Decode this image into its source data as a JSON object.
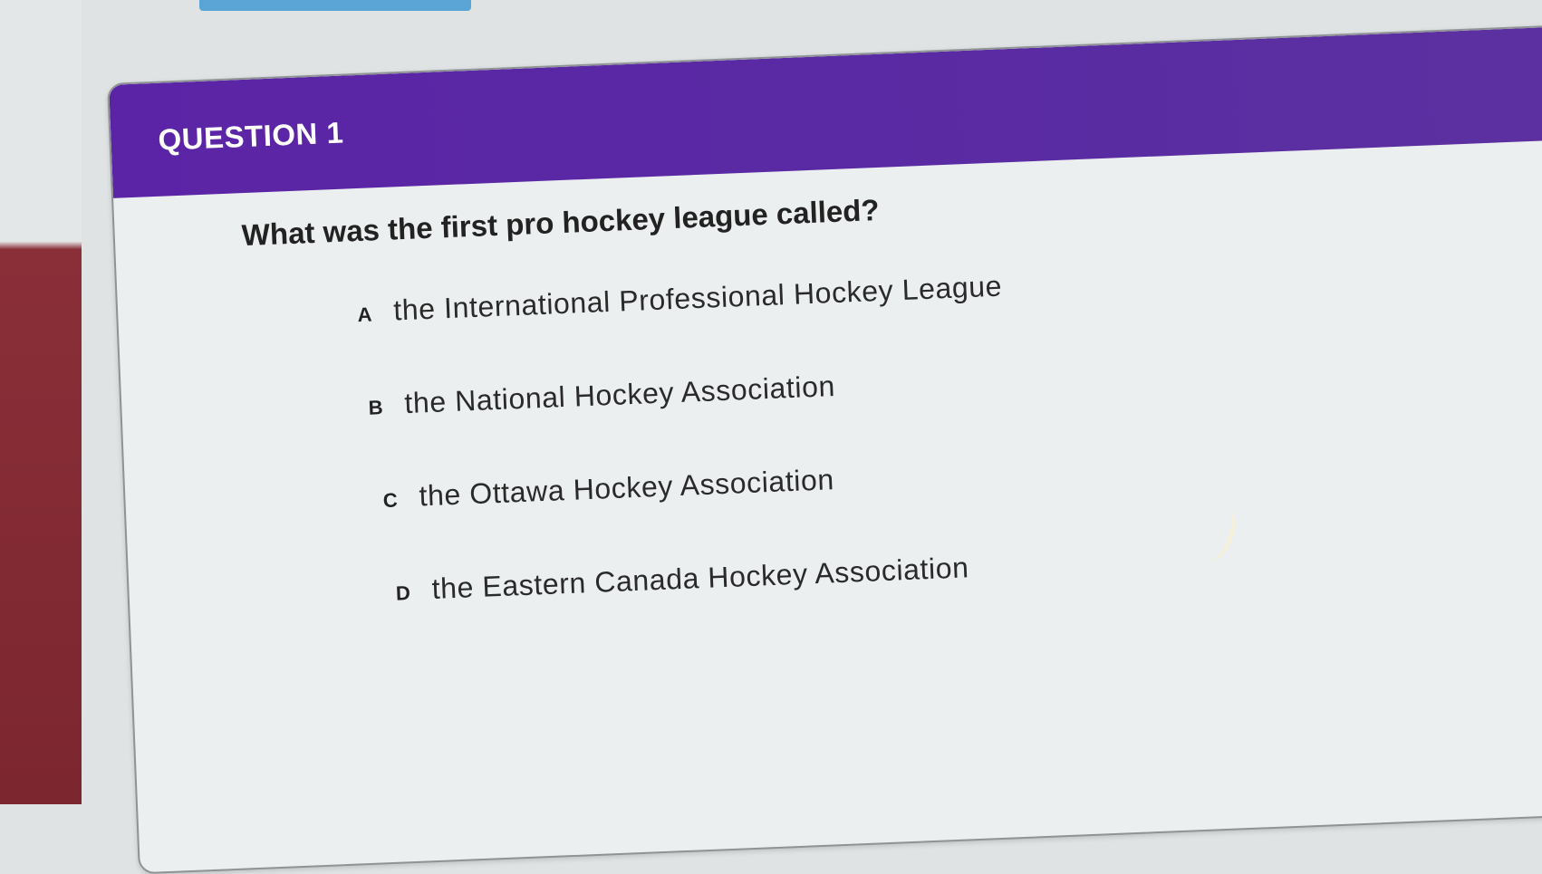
{
  "question": {
    "number_label": "QUESTION 1",
    "prompt": "What was the first pro hockey league called?",
    "options": [
      {
        "letter": "A",
        "text": "the International Professional Hockey League"
      },
      {
        "letter": "B",
        "text": "the National Hockey Association"
      },
      {
        "letter": "C",
        "text": "the Ottawa Hockey Association"
      },
      {
        "letter": "D",
        "text": "the Eastern Canada Hockey Association"
      }
    ]
  },
  "colors": {
    "header": "#5b24a6",
    "card_background": "#eceff0",
    "text": "#222222"
  }
}
